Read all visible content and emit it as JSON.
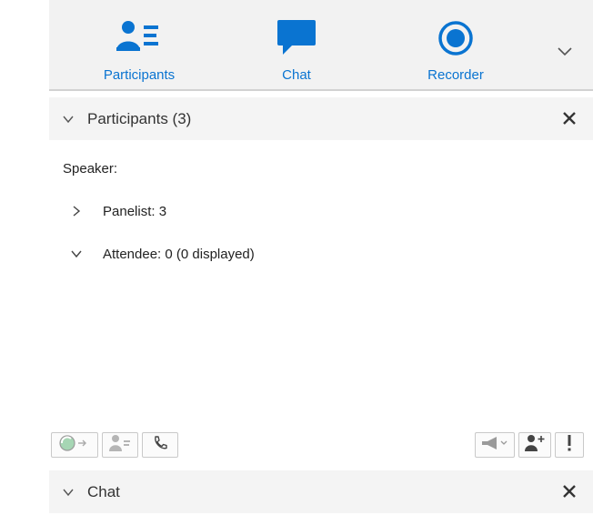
{
  "colors": {
    "accent": "#0a74d1",
    "header_bg": "#f4f4f4",
    "toolbar_icon": "#9a9a9a"
  },
  "tabs": [
    {
      "label": "Participants",
      "icon": "participants-icon"
    },
    {
      "label": "Chat",
      "icon": "chat-bubble-icon"
    },
    {
      "label": "Recorder",
      "icon": "record-icon"
    }
  ],
  "participants_panel": {
    "title": "Participants (3)",
    "speaker_label": "Speaker:",
    "groups": [
      {
        "label": "Panelist: 3",
        "expanded": false
      },
      {
        "label": "Attendee: 0 (0 displayed)",
        "expanded": true
      }
    ]
  },
  "toolbar": {
    "left_buttons": [
      "mute-all-icon",
      "move-to-stage-icon",
      "call-icon"
    ],
    "right_buttons": [
      "announce-icon",
      "invite-icon",
      "alert-icon"
    ]
  },
  "chat_panel": {
    "title": "Chat"
  }
}
